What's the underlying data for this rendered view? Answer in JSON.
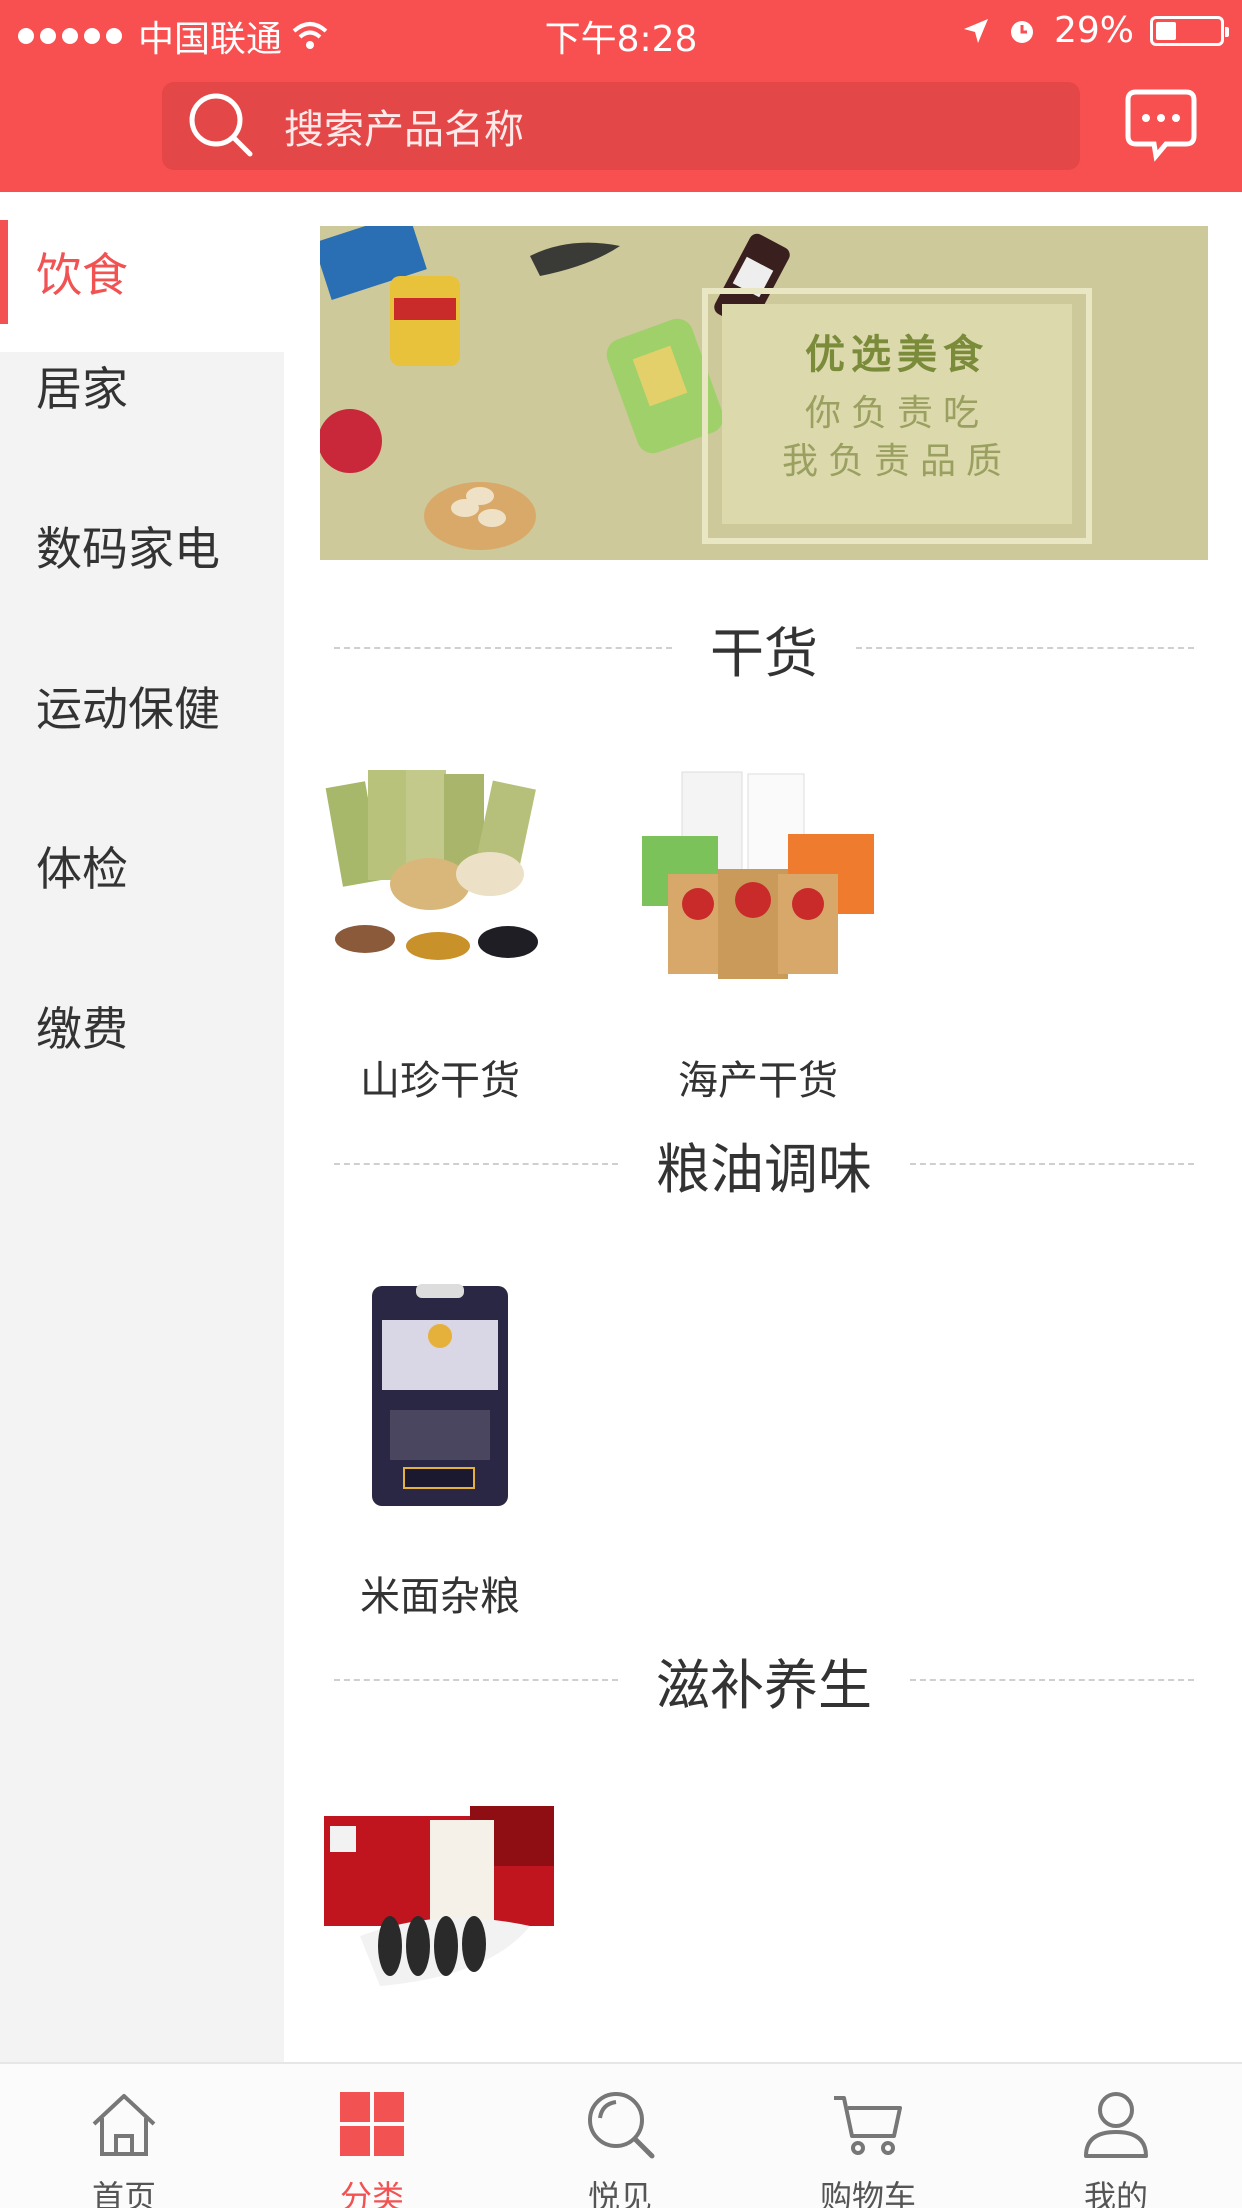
{
  "status_bar": {
    "carrier": "中国联通",
    "time": "下午8:28",
    "battery": "29%"
  },
  "search": {
    "placeholder": "搜索产品名称"
  },
  "sidebar": {
    "items": [
      {
        "label": "饮食",
        "active": true
      },
      {
        "label": "居家"
      },
      {
        "label": "数码家电"
      },
      {
        "label": "运动保健"
      },
      {
        "label": "体检"
      },
      {
        "label": "缴费"
      }
    ]
  },
  "banner": {
    "title": "优选美食",
    "line1": "你负责吃",
    "line2": "我负责品质"
  },
  "sections": [
    {
      "title": "干货",
      "products": [
        {
          "name": "山珍干货"
        },
        {
          "name": "海产干货"
        }
      ]
    },
    {
      "title": "粮油调味",
      "products": [
        {
          "name": "米面杂粮"
        }
      ]
    },
    {
      "title": "滋补养生",
      "products": [
        {
          "name": ""
        }
      ]
    }
  ],
  "tabbar": {
    "items": [
      {
        "label": "首页",
        "icon": "home-icon"
      },
      {
        "label": "分类",
        "icon": "category-icon",
        "active": true
      },
      {
        "label": "悦见",
        "icon": "discover-icon"
      },
      {
        "label": "购物车",
        "icon": "cart-icon"
      },
      {
        "label": "我的",
        "icon": "profile-icon"
      }
    ]
  },
  "colors": {
    "brand_red": "#f85050",
    "active_red": "#f25252"
  }
}
